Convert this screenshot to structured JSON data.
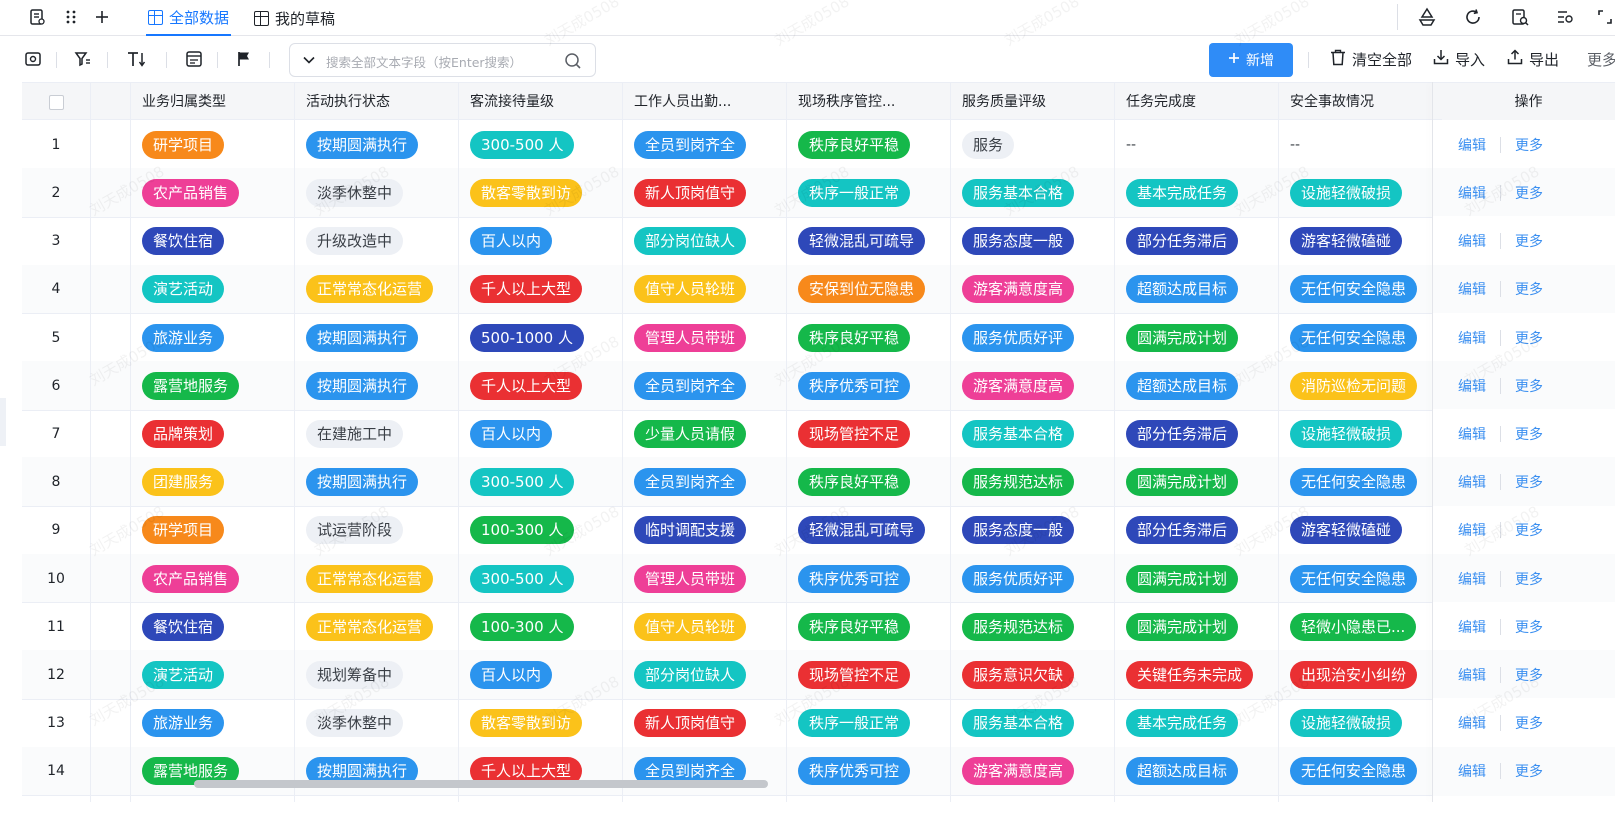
{
  "tabs": [
    {
      "label": "全部数据",
      "active": true
    },
    {
      "label": "我的草稿",
      "active": false
    }
  ],
  "toolbar": {
    "search_placeholder": "搜索全部文本字段（按Enter搜索）",
    "add_label": "新增",
    "clear_label": "清空全部",
    "import_label": "导入",
    "export_label": "导出",
    "more_label": "更多"
  },
  "columns": [
    "业务归属类型",
    "活动执行状态",
    "客流接待量级",
    "工作人员出勤...",
    "现场秩序管控...",
    "服务质量评级",
    "任务完成度",
    "安全事故情况",
    "操作"
  ],
  "ops": {
    "edit": "编辑",
    "more": "更多"
  },
  "watermark": "刘天成0508",
  "colors": {
    "accent": "#1677ff",
    "orange": "#f7891b",
    "pink": "#ee3f97",
    "navy": "#2e48b9",
    "teal": "#14c5c3",
    "blue": "#2b94ee",
    "green": "#15b84a",
    "red": "#ea3033",
    "yellow": "#fbc21a",
    "gray": "#edf0f5"
  },
  "rows": [
    {
      "no": "1",
      "cells": [
        {
          "t": "研学项目",
          "c": "orange"
        },
        {
          "t": "按期圆满执行",
          "c": "blue"
        },
        {
          "t": "300-500 人",
          "c": "teal"
        },
        {
          "t": "全员到岗齐全",
          "c": "blue"
        },
        {
          "t": "秩序良好平稳",
          "c": "green"
        },
        {
          "t": "服务",
          "c": "gray"
        },
        {
          "t": "--",
          "c": "none"
        },
        {
          "t": "--",
          "c": "none"
        }
      ]
    },
    {
      "no": "2",
      "cells": [
        {
          "t": "农产品销售",
          "c": "pink"
        },
        {
          "t": "淡季休整中",
          "c": "gray"
        },
        {
          "t": "散客零散到访",
          "c": "yellow"
        },
        {
          "t": "新人顶岗值守",
          "c": "red"
        },
        {
          "t": "秩序一般正常",
          "c": "teal"
        },
        {
          "t": "服务基本合格",
          "c": "teal"
        },
        {
          "t": "基本完成任务",
          "c": "teal"
        },
        {
          "t": "设施轻微破损",
          "c": "teal"
        }
      ]
    },
    {
      "no": "3",
      "cells": [
        {
          "t": "餐饮住宿",
          "c": "navy"
        },
        {
          "t": "升级改造中",
          "c": "gray"
        },
        {
          "t": "百人以内",
          "c": "blue"
        },
        {
          "t": "部分岗位缺人",
          "c": "teal"
        },
        {
          "t": "轻微混乱可疏导",
          "c": "navy"
        },
        {
          "t": "服务态度一般",
          "c": "navy"
        },
        {
          "t": "部分任务滞后",
          "c": "navy"
        },
        {
          "t": "游客轻微磕碰",
          "c": "navy"
        }
      ]
    },
    {
      "no": "4",
      "cells": [
        {
          "t": "演艺活动",
          "c": "teal"
        },
        {
          "t": "正常常态化运营",
          "c": "yellow"
        },
        {
          "t": "千人以上大型",
          "c": "red"
        },
        {
          "t": "值守人员轮班",
          "c": "yellow"
        },
        {
          "t": "安保到位无隐患",
          "c": "orange"
        },
        {
          "t": "游客满意度高",
          "c": "pink"
        },
        {
          "t": "超额达成目标",
          "c": "blue"
        },
        {
          "t": "无任何安全隐患",
          "c": "blue"
        }
      ]
    },
    {
      "no": "5",
      "cells": [
        {
          "t": "旅游业务",
          "c": "blue"
        },
        {
          "t": "按期圆满执行",
          "c": "blue"
        },
        {
          "t": "500-1000 人",
          "c": "navy"
        },
        {
          "t": "管理人员带班",
          "c": "pink"
        },
        {
          "t": "秩序良好平稳",
          "c": "green"
        },
        {
          "t": "服务优质好评",
          "c": "blue"
        },
        {
          "t": "圆满完成计划",
          "c": "green"
        },
        {
          "t": "无任何安全隐患",
          "c": "blue"
        }
      ]
    },
    {
      "no": "6",
      "cells": [
        {
          "t": "露营地服务",
          "c": "green"
        },
        {
          "t": "按期圆满执行",
          "c": "blue"
        },
        {
          "t": "千人以上大型",
          "c": "red"
        },
        {
          "t": "全员到岗齐全",
          "c": "blue"
        },
        {
          "t": "秩序优秀可控",
          "c": "blue"
        },
        {
          "t": "游客满意度高",
          "c": "pink"
        },
        {
          "t": "超额达成目标",
          "c": "blue"
        },
        {
          "t": "消防巡检无问题",
          "c": "yellow"
        }
      ]
    },
    {
      "no": "7",
      "cells": [
        {
          "t": "品牌策划",
          "c": "red"
        },
        {
          "t": "在建施工中",
          "c": "gray"
        },
        {
          "t": "百人以内",
          "c": "blue"
        },
        {
          "t": "少量人员请假",
          "c": "green"
        },
        {
          "t": "现场管控不足",
          "c": "red"
        },
        {
          "t": "服务基本合格",
          "c": "teal"
        },
        {
          "t": "部分任务滞后",
          "c": "navy"
        },
        {
          "t": "设施轻微破损",
          "c": "teal"
        }
      ]
    },
    {
      "no": "8",
      "cells": [
        {
          "t": "团建服务",
          "c": "yellow"
        },
        {
          "t": "按期圆满执行",
          "c": "blue"
        },
        {
          "t": "300-500 人",
          "c": "teal"
        },
        {
          "t": "全员到岗齐全",
          "c": "blue"
        },
        {
          "t": "秩序良好平稳",
          "c": "green"
        },
        {
          "t": "服务规范达标",
          "c": "green"
        },
        {
          "t": "圆满完成计划",
          "c": "green"
        },
        {
          "t": "无任何安全隐患",
          "c": "blue"
        }
      ]
    },
    {
      "no": "9",
      "cells": [
        {
          "t": "研学项目",
          "c": "orange"
        },
        {
          "t": "试运营阶段",
          "c": "gray"
        },
        {
          "t": "100-300 人",
          "c": "green"
        },
        {
          "t": "临时调配支援",
          "c": "navy"
        },
        {
          "t": "轻微混乱可疏导",
          "c": "navy"
        },
        {
          "t": "服务态度一般",
          "c": "navy"
        },
        {
          "t": "部分任务滞后",
          "c": "navy"
        },
        {
          "t": "游客轻微磕碰",
          "c": "navy"
        }
      ]
    },
    {
      "no": "10",
      "cells": [
        {
          "t": "农产品销售",
          "c": "pink"
        },
        {
          "t": "正常常态化运营",
          "c": "yellow"
        },
        {
          "t": "300-500 人",
          "c": "teal"
        },
        {
          "t": "管理人员带班",
          "c": "pink"
        },
        {
          "t": "秩序优秀可控",
          "c": "blue"
        },
        {
          "t": "服务优质好评",
          "c": "blue"
        },
        {
          "t": "圆满完成计划",
          "c": "green"
        },
        {
          "t": "无任何安全隐患",
          "c": "blue"
        }
      ]
    },
    {
      "no": "11",
      "cells": [
        {
          "t": "餐饮住宿",
          "c": "navy"
        },
        {
          "t": "正常常态化运营",
          "c": "yellow"
        },
        {
          "t": "100-300 人",
          "c": "green"
        },
        {
          "t": "值守人员轮班",
          "c": "yellow"
        },
        {
          "t": "秩序良好平稳",
          "c": "green"
        },
        {
          "t": "服务规范达标",
          "c": "green"
        },
        {
          "t": "圆满完成计划",
          "c": "green"
        },
        {
          "t": "轻微小隐患已...",
          "c": "green"
        }
      ]
    },
    {
      "no": "12",
      "cells": [
        {
          "t": "演艺活动",
          "c": "teal"
        },
        {
          "t": "规划筹备中",
          "c": "gray"
        },
        {
          "t": "百人以内",
          "c": "blue"
        },
        {
          "t": "部分岗位缺人",
          "c": "teal"
        },
        {
          "t": "现场管控不足",
          "c": "red"
        },
        {
          "t": "服务意识欠缺",
          "c": "red"
        },
        {
          "t": "关键任务未完成",
          "c": "red"
        },
        {
          "t": "出现治安小纠纷",
          "c": "red"
        }
      ]
    },
    {
      "no": "13",
      "cells": [
        {
          "t": "旅游业务",
          "c": "blue"
        },
        {
          "t": "淡季休整中",
          "c": "gray"
        },
        {
          "t": "散客零散到访",
          "c": "yellow"
        },
        {
          "t": "新人顶岗值守",
          "c": "red"
        },
        {
          "t": "秩序一般正常",
          "c": "teal"
        },
        {
          "t": "服务基本合格",
          "c": "teal"
        },
        {
          "t": "基本完成任务",
          "c": "teal"
        },
        {
          "t": "设施轻微破损",
          "c": "teal"
        }
      ]
    },
    {
      "no": "14",
      "cells": [
        {
          "t": "露营地服务",
          "c": "green"
        },
        {
          "t": "按期圆满执行",
          "c": "blue"
        },
        {
          "t": "千人以上大型",
          "c": "red"
        },
        {
          "t": "全员到岗齐全",
          "c": "blue"
        },
        {
          "t": "秩序优秀可控",
          "c": "blue"
        },
        {
          "t": "游客满意度高",
          "c": "pink"
        },
        {
          "t": "超额达成目标",
          "c": "blue"
        },
        {
          "t": "无任何安全隐患",
          "c": "blue"
        }
      ]
    }
  ]
}
